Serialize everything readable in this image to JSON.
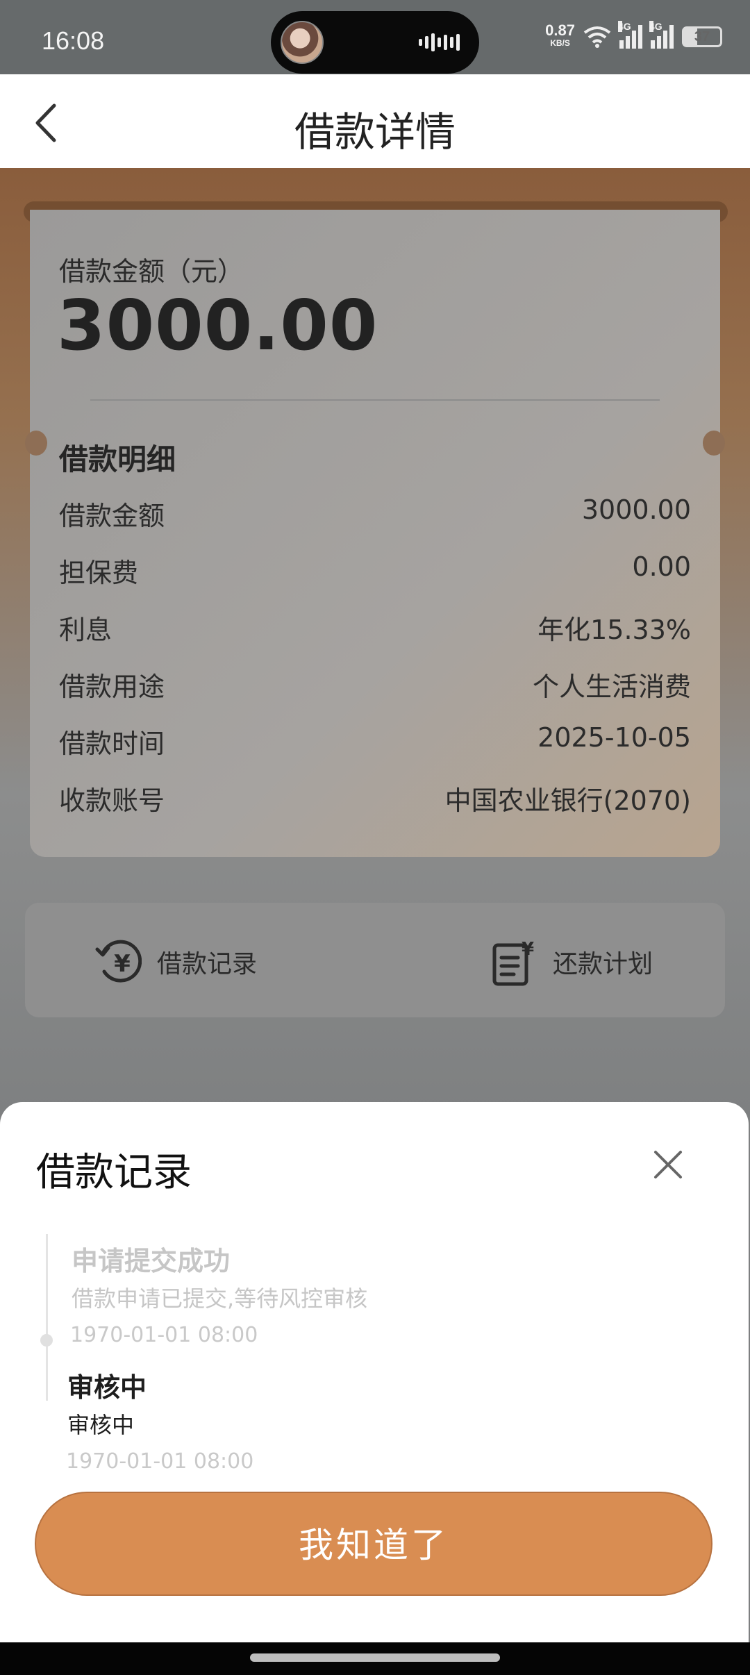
{
  "status_bar": {
    "time": "16:08",
    "net_speed": "0.87",
    "net_unit": "KB/S",
    "sim1": "4G",
    "sim2": "4G",
    "battery": "37"
  },
  "header": {
    "title": "借款详情"
  },
  "loan": {
    "amount_label": "借款金额（元）",
    "amount": "3000.00",
    "detail_title": "借款明细",
    "rows": [
      {
        "label": "借款金额",
        "value": "3000.00"
      },
      {
        "label": "担保费",
        "value": "0.00"
      },
      {
        "label": "利息",
        "value": "年化15.33%"
      },
      {
        "label": "借款用途",
        "value": "个人生活消费"
      },
      {
        "label": "借款时间",
        "value": "2025-10-05"
      },
      {
        "label": "收款账号",
        "value": "中国农业银行(2070)"
      }
    ]
  },
  "actions": {
    "records_label": "借款记录",
    "plan_label": "还款计划"
  },
  "sheet": {
    "title": "借款记录",
    "steps": [
      {
        "title": "申请提交成功",
        "desc": "借款申请已提交,等待风控审核",
        "time": "1970-01-01 08:00"
      },
      {
        "title": "审核中",
        "desc": "审核中",
        "time": "1970-01-01 08:00"
      }
    ],
    "ok_label": "我知道了"
  },
  "colors": {
    "accent": "#d98d52",
    "header_bg": "#ffffff",
    "overlay": "#7d7f80"
  }
}
